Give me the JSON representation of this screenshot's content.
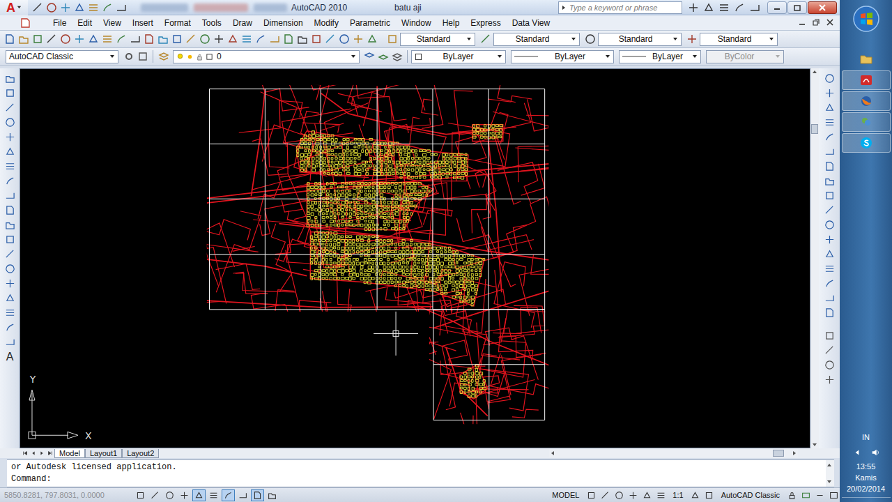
{
  "app": {
    "logo": "A",
    "title": "AutoCAD 2010",
    "drawing": "batu aji",
    "search_placeholder": "Type a keyword or phrase"
  },
  "menu": [
    "File",
    "Edit",
    "View",
    "Insert",
    "Format",
    "Tools",
    "Draw",
    "Dimension",
    "Modify",
    "Parametric",
    "Window",
    "Help",
    "Express",
    "Data View"
  ],
  "style_dropdowns": [
    "Standard",
    "Standard",
    "Standard",
    "Standard"
  ],
  "workspace_dropdown": "AutoCAD Classic",
  "layer": {
    "name": "0"
  },
  "properties": [
    {
      "label": "ByLayer",
      "kind": "color",
      "disabled": false
    },
    {
      "label": "ByLayer",
      "kind": "linetype",
      "disabled": false
    },
    {
      "label": "ByLayer",
      "kind": "lineweight",
      "disabled": false
    },
    {
      "label": "ByColor",
      "kind": "plotstyle",
      "disabled": true
    }
  ],
  "draw_toolbar_text_tool": "A",
  "ucs": {
    "x": "X",
    "y": "Y"
  },
  "layout_tabs": [
    {
      "label": "Model",
      "selected": true
    },
    {
      "label": "Layout1",
      "selected": false
    },
    {
      "label": "Layout2",
      "selected": false
    }
  ],
  "command_history": [
    "or Autodesk licensed application."
  ],
  "command_prompt": "Command:",
  "status_bar": {
    "coordinates": "5850.8281, 797.8031, 0.0000",
    "toggles": [
      {
        "on": false
      },
      {
        "on": false
      },
      {
        "on": false
      },
      {
        "on": false
      },
      {
        "on": true
      },
      {
        "on": false
      },
      {
        "on": true
      },
      {
        "on": false
      },
      {
        "on": true
      },
      {
        "on": false
      }
    ],
    "space": "MODEL",
    "annotation_scale": "1:1",
    "workspace": "AutoCAD Classic"
  },
  "taskbar": {
    "pinned": [
      {
        "kind": "folder",
        "running": false
      },
      {
        "kind": "acrobat",
        "running": true
      },
      {
        "kind": "firefox",
        "running": true
      },
      {
        "kind": "messenger",
        "running": true
      },
      {
        "kind": "skype",
        "running": true
      }
    ],
    "language": "IN",
    "time": "13:55",
    "day": "Kamis",
    "date": "20/02/2014"
  }
}
